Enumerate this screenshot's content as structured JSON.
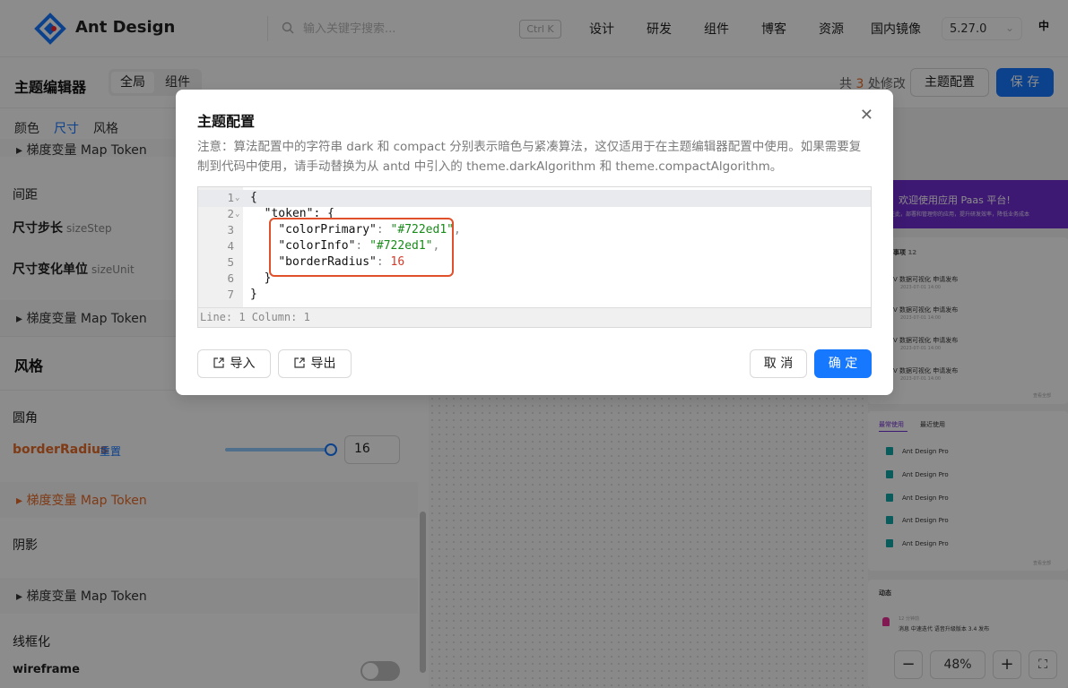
{
  "header": {
    "brand": "Ant Design",
    "search_placeholder": "输入关键字搜索...",
    "shortcut": "Ctrl K",
    "nav": [
      "设计",
      "研发",
      "组件",
      "博客",
      "资源",
      "国内镜像"
    ],
    "version": "5.27.0",
    "lang": "中"
  },
  "subbar": {
    "title": "主题编辑器",
    "scope_tabs": [
      "全局",
      "组件"
    ],
    "changes_prefix": "共",
    "changes_count": "3",
    "changes_suffix": "处修改",
    "theme_config_label": "主题配置",
    "save_label": "保 存"
  },
  "left_panel": {
    "tabs": [
      "颜色",
      "尺寸",
      "风格"
    ],
    "map_token_label": "梯度变量 Map Token",
    "spacing_title": "间距",
    "size_step_label": "尺寸步长",
    "size_step_hint": "sizeStep",
    "size_unit_label": "尺寸变化单位",
    "size_unit_hint": "sizeUnit",
    "style_title": "风格",
    "radius_title": "圆角",
    "border_radius_label": "borderRadius",
    "reset_label": "重置",
    "border_radius_value": "16",
    "slider_fraction": 0.98,
    "shadow_title": "阴影",
    "wireframe_title": "线框化",
    "wireframe_label": "wireframe",
    "wireframe_on": false
  },
  "preview": {
    "banner_title": "欢迎使用应用 Paas 平台!",
    "banner_sub": "在此，部署和管理你的应用，提升研发效率，降低业务成本",
    "todo_title": "事项",
    "todo_count": "12",
    "todo_items": [
      {
        "title": "V 数据可视化 申请发布",
        "time": "2023-07-01 14:00"
      },
      {
        "title": "V 数据可视化 申请发布",
        "time": "2023-07-01 14:00"
      },
      {
        "title": "V 数据可视化 申请发布",
        "time": "2023-07-01 14:00"
      },
      {
        "title": "V 数据可视化 申请发布",
        "time": "2023-07-01 14:00"
      }
    ],
    "view_all": "查看全部",
    "recent_tabs": [
      "最常使用",
      "最近使用"
    ],
    "recent_items": [
      "Ant Design Pro",
      "Ant Design Pro",
      "Ant Design Pro",
      "Ant Design Pro",
      "Ant Design Pro"
    ],
    "activity_title": "动态",
    "activity_time": "12 分钟前",
    "activity_text": "消息 中速迭代 语音升级版本 3.4 发布",
    "zoom": "48%"
  },
  "modal": {
    "title": "主题配置",
    "note": "注意：算法配置中的字符串 dark 和 compact 分别表示暗色与紧凑算法，这仅适用于在主题编辑器配置中使用。如果需要复制到代码中使用，请手动替换为从 antd 中引入的 theme.darkAlgorithm 和 theme.compactAlgorithm。",
    "code_lines": [
      {
        "n": "1",
        "fold": true,
        "text": "{"
      },
      {
        "n": "2",
        "fold": true,
        "text": "  \"token\": {"
      },
      {
        "n": "3",
        "fold": false,
        "key": "\"colorPrimary\"",
        "val": "\"#722ed1\"",
        "type": "s",
        "comma": ","
      },
      {
        "n": "4",
        "fold": false,
        "key": "\"colorInfo\"",
        "val": "\"#722ed1\"",
        "type": "s",
        "comma": ","
      },
      {
        "n": "5",
        "fold": false,
        "key": "\"borderRadius\"",
        "val": "16",
        "type": "n",
        "comma": ""
      },
      {
        "n": "6",
        "fold": false,
        "text": "  }"
      },
      {
        "n": "7",
        "fold": false,
        "text": "}"
      }
    ],
    "status": "Line: 1  Column: 1",
    "import_label": "导入",
    "export_label": "导出",
    "cancel_label": "取 消",
    "ok_label": "确 定"
  },
  "colors": {
    "accent": "#1677ff",
    "highlight": "#e0502a",
    "warning": "#e86b28",
    "purple": "#722ed1"
  }
}
